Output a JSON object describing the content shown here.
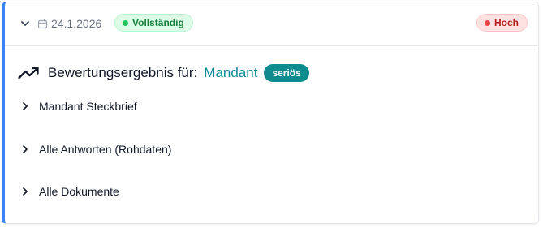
{
  "header": {
    "date": "24.1.2026",
    "status_badge": "Vollständig",
    "priority_badge": "Hoch"
  },
  "result": {
    "label": "Bewertungsergebnis für:",
    "link": "Mandant",
    "rating_badge": "seriös"
  },
  "sections": [
    {
      "label": "Mandant Steckbrief"
    },
    {
      "label": "Alle Antworten (Rohdaten)"
    },
    {
      "label": "Alle Dokumente"
    }
  ],
  "colors": {
    "accent_border": "#3b82f6",
    "complete_green": "#22c55e",
    "high_red": "#ef4444",
    "link_teal": "#0d8a96",
    "rating_teal": "#0e8b8d"
  },
  "icons": {
    "collapse": "chevron-down-icon",
    "date": "calendar-icon",
    "result": "trending-up-icon",
    "section": "chevron-right-icon"
  }
}
